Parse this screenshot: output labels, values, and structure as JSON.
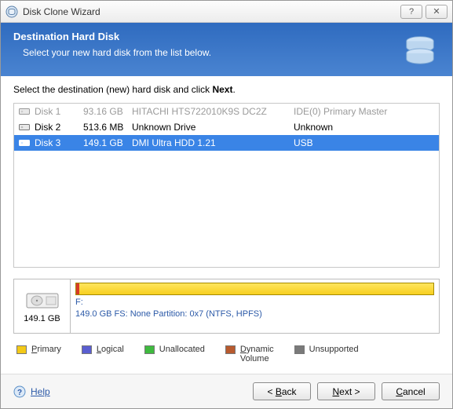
{
  "window": {
    "title": "Disk Clone Wizard"
  },
  "header": {
    "title": "Destination Hard Disk",
    "subtitle": "Select your new hard disk from the list below."
  },
  "instruction": {
    "prefix": "Select the destination (new) hard disk and click ",
    "bold": "Next",
    "suffix": "."
  },
  "disks": [
    {
      "name": "Disk 1",
      "size": "93.16 GB",
      "model": "HITACHI HTS722010K9S DC2Z",
      "iface": "IDE(0) Primary Master",
      "state": "disabled"
    },
    {
      "name": "Disk 2",
      "size": "513.6 MB",
      "model": "Unknown Drive",
      "iface": "Unknown",
      "state": "normal"
    },
    {
      "name": "Disk 3",
      "size": "149.1 GB",
      "model": "DMI Ultra HDD 1.21",
      "iface": "USB",
      "state": "selected"
    }
  ],
  "detail": {
    "total_size": "149.1 GB",
    "drive_letter": "F:",
    "info_line": "149.0 GB  FS: None Partition: 0x7 (NTFS, HPFS)"
  },
  "legend": {
    "primary": {
      "label": "Primary",
      "color": "#f3c917"
    },
    "logical": {
      "label": "Logical",
      "color": "#5a5ed0"
    },
    "unallocated": {
      "label": "Unallocated",
      "color": "#3fba3f"
    },
    "dynamic": {
      "label_line1": "Dynamic",
      "label_line2": "Volume",
      "color": "#b85a2e"
    },
    "unsupported": {
      "label": "Unsupported",
      "color": "#7a7a7a"
    }
  },
  "footer": {
    "help": "Help",
    "back": "< Back",
    "next": "Next >",
    "cancel": "Cancel"
  }
}
